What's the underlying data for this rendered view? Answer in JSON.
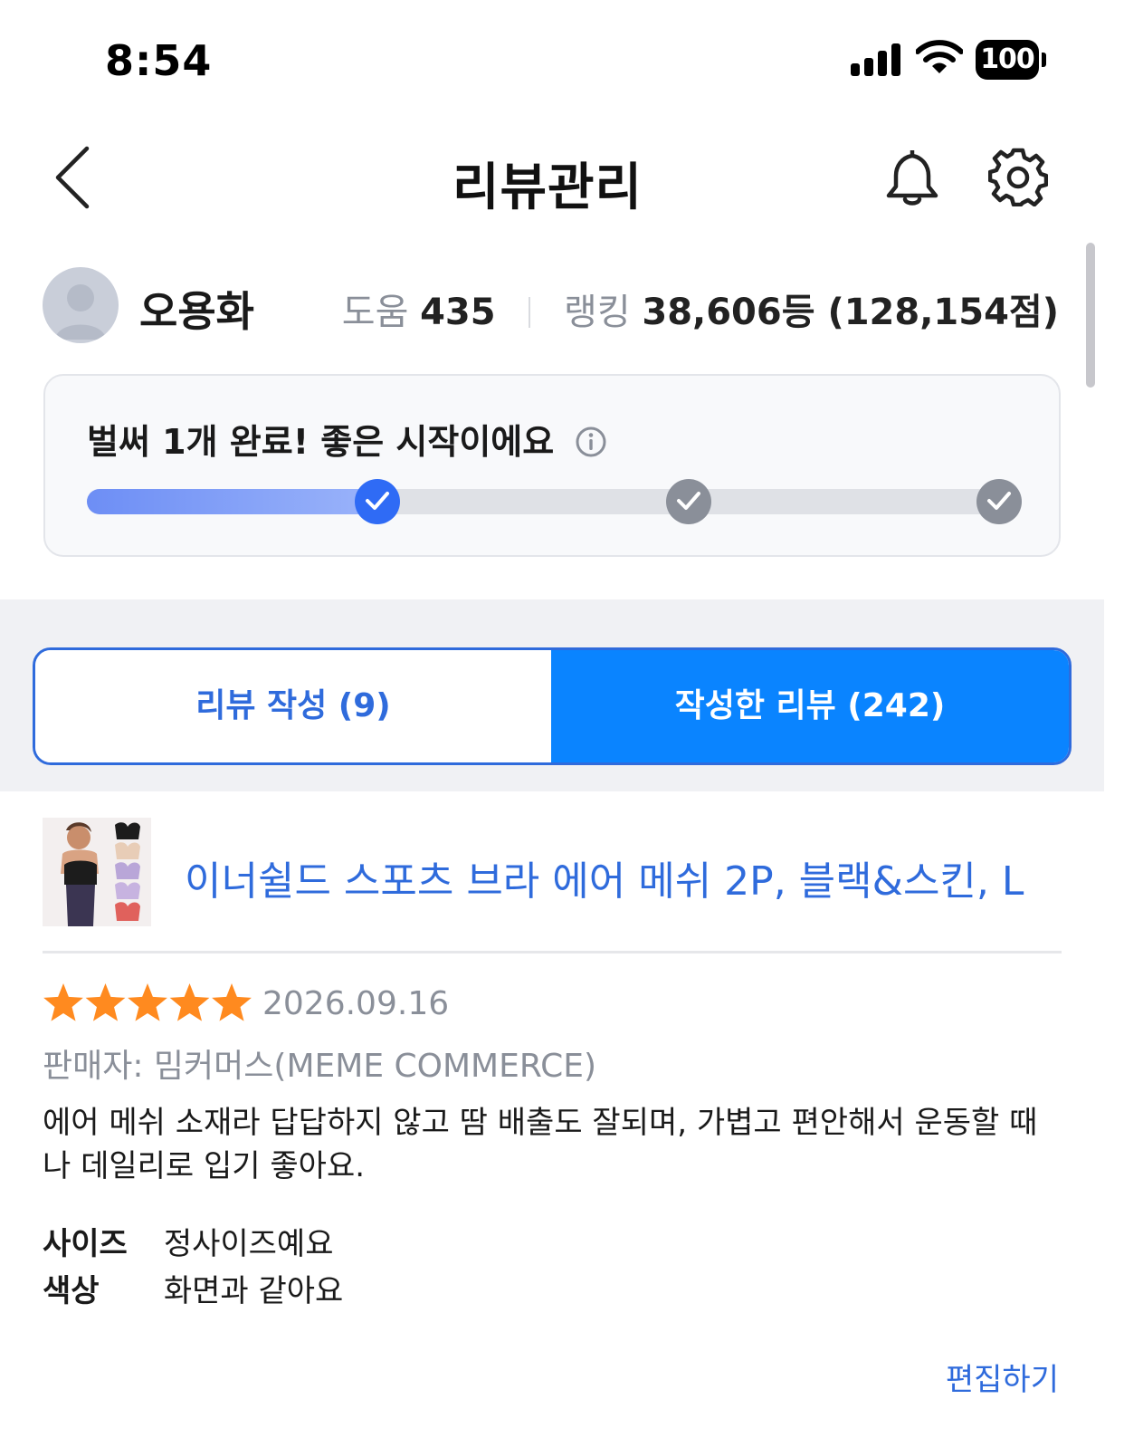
{
  "status_bar": {
    "time": "8:54",
    "battery": "100"
  },
  "header": {
    "title": "리뷰관리"
  },
  "profile": {
    "name": "오용화",
    "help_label": "도움",
    "help_value": "435",
    "ranking_label": "랭킹",
    "ranking_value": "38,606등 (128,154점)"
  },
  "progress": {
    "title": "벌써 1개 완료! 좋은 시작이에요",
    "completed_steps": 1,
    "total_steps": 3,
    "fill_fraction": 0.31
  },
  "tabs": [
    {
      "label": "리뷰 작성 (9)",
      "active": false
    },
    {
      "label": "작성한 리뷰 (242)",
      "active": true
    }
  ],
  "product": {
    "title": "이너쉴드 스포츠 브라 에어 메쉬 2P, 블랙&스킨, L"
  },
  "review": {
    "rating": 5,
    "date": "2026.09.16",
    "seller": "판매자: 밈커머스(MEME COMMERCE)",
    "text": "에어 메쉬 소재라 답답하지 않고 땀 배출도 잘되며, 가볍고 편안해서 운동할 때나 데일리로 입기 좋아요.",
    "attributes": [
      {
        "key": "사이즈",
        "value": "정사이즈예요"
      },
      {
        "key": "색상",
        "value": "화면과 같아요"
      }
    ],
    "edit_label": "편집하기"
  },
  "colors": {
    "accent": "#2f6bdc",
    "active_tab": "#0a84ff",
    "star": "#ff8a1f",
    "muted": "#8a8f99"
  }
}
